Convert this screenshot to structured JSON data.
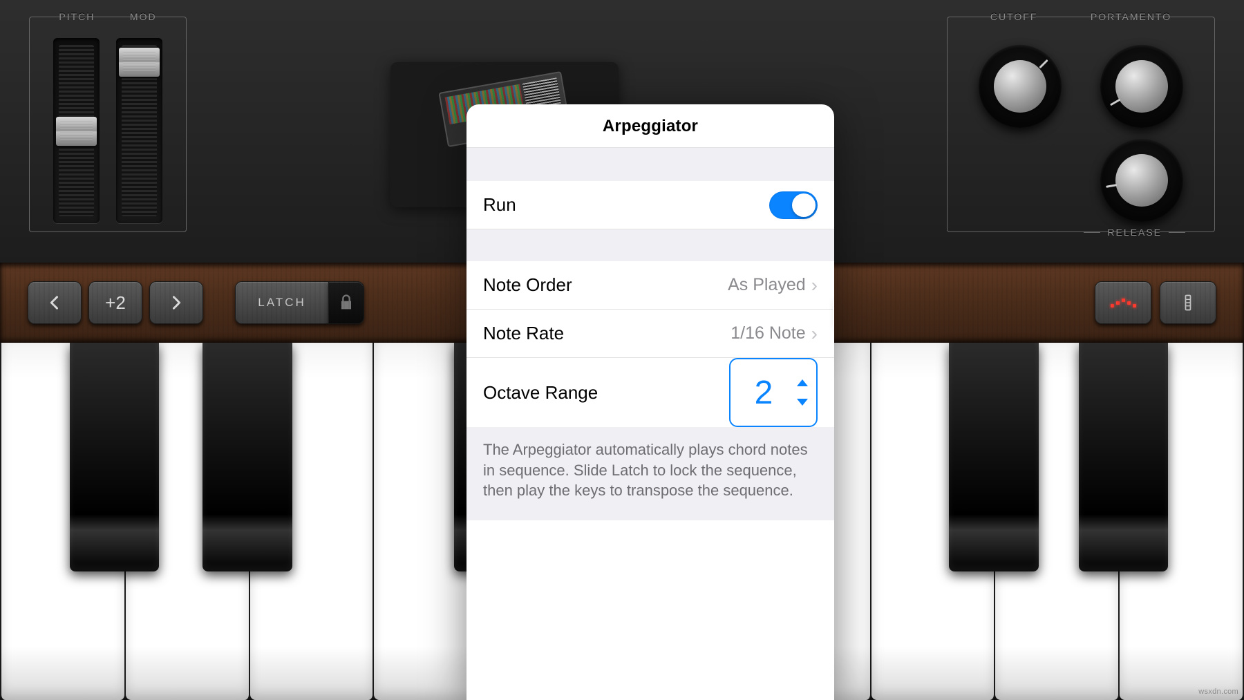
{
  "left_panel": {
    "pitch_label": "PITCH",
    "mod_label": "MOD"
  },
  "right_panel": {
    "cutoff_label": "CUTOFF",
    "portamento_label": "PORTAMENTO",
    "release_label": "RELEASE"
  },
  "toolbar": {
    "octave_value": "+2",
    "latch_label": "LATCH"
  },
  "popover": {
    "title": "Arpeggiator",
    "run_label": "Run",
    "run_on": true,
    "note_order_label": "Note Order",
    "note_order_value": "As Played",
    "note_rate_label": "Note Rate",
    "note_rate_value": "1/16 Note",
    "octave_range_label": "Octave Range",
    "octave_range_value": "2",
    "footer": "The Arpeggiator automatically plays chord notes in sequence. Slide Latch to lock the sequence, then play the keys to transpose the sequence."
  },
  "watermark": "wsxdn.com"
}
